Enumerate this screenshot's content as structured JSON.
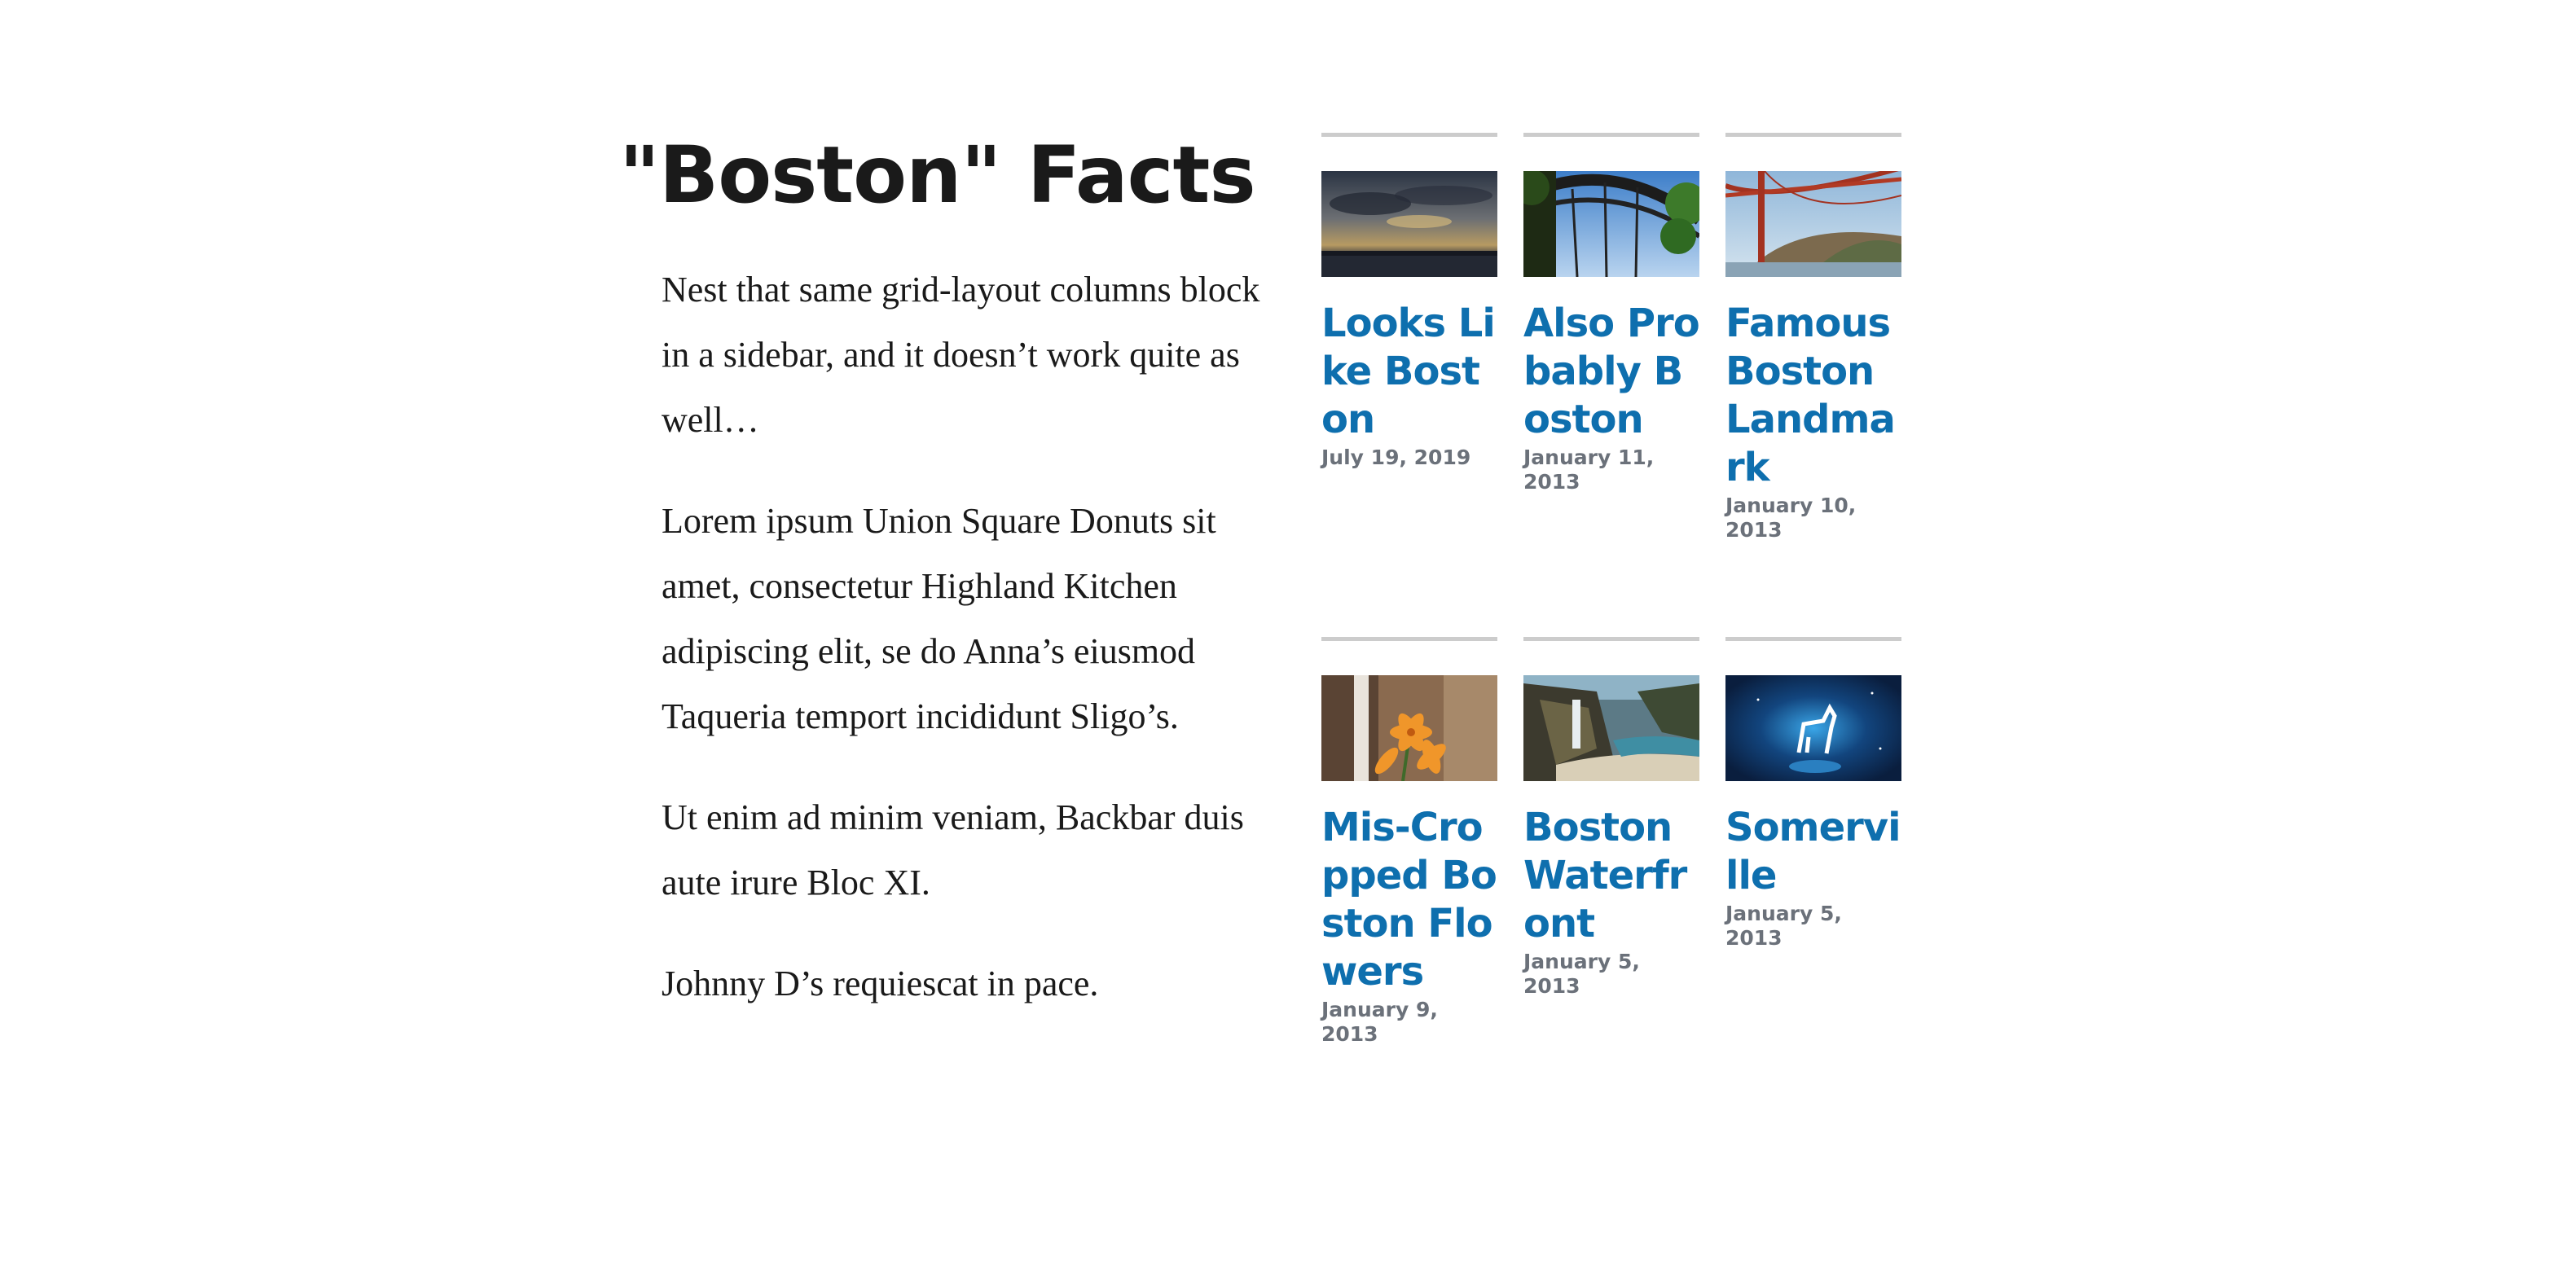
{
  "page_title": "\"Boston\" Facts",
  "paragraphs": [
    "Nest that same grid-layout columns block in a sidebar, and it doesn’t work quite as well…",
    "Lorem ipsum Union Square Donuts sit amet, consectetur Highland Kitchen adipiscing elit, se do Anna’s eiusmod Taqueria temport incididunt Sligo’s.",
    "Ut enim ad minim veniam, Backbar duis aute irure Bloc XI.",
    "Johnny D’s requiescat in pace."
  ],
  "colors": {
    "link": "#0e6fae",
    "date": "#6b717a",
    "divider": "#cccccc",
    "text": "#1a1a1a"
  },
  "posts": [
    {
      "title": "Looks Like Boston",
      "date": "July 19, 2019",
      "image": "sunset-over-water-photo"
    },
    {
      "title": "Also Probably Boston",
      "date": "January 11, 2013",
      "image": "arch-bridge-photo"
    },
    {
      "title": "Famous Boston Landmark",
      "date": "January 10, 2013",
      "image": "suspension-bridge-photo"
    },
    {
      "title": "Mis-Cropped Boston Flowers",
      "date": "January 9, 2013",
      "image": "orange-lily-photo"
    },
    {
      "title": "Boston Waterfront",
      "date": "January 5, 2013",
      "image": "waterfall-beach-photo"
    },
    {
      "title": "Somerville",
      "date": "January 5, 2013",
      "image": "unicorn-moon-illustration"
    }
  ]
}
